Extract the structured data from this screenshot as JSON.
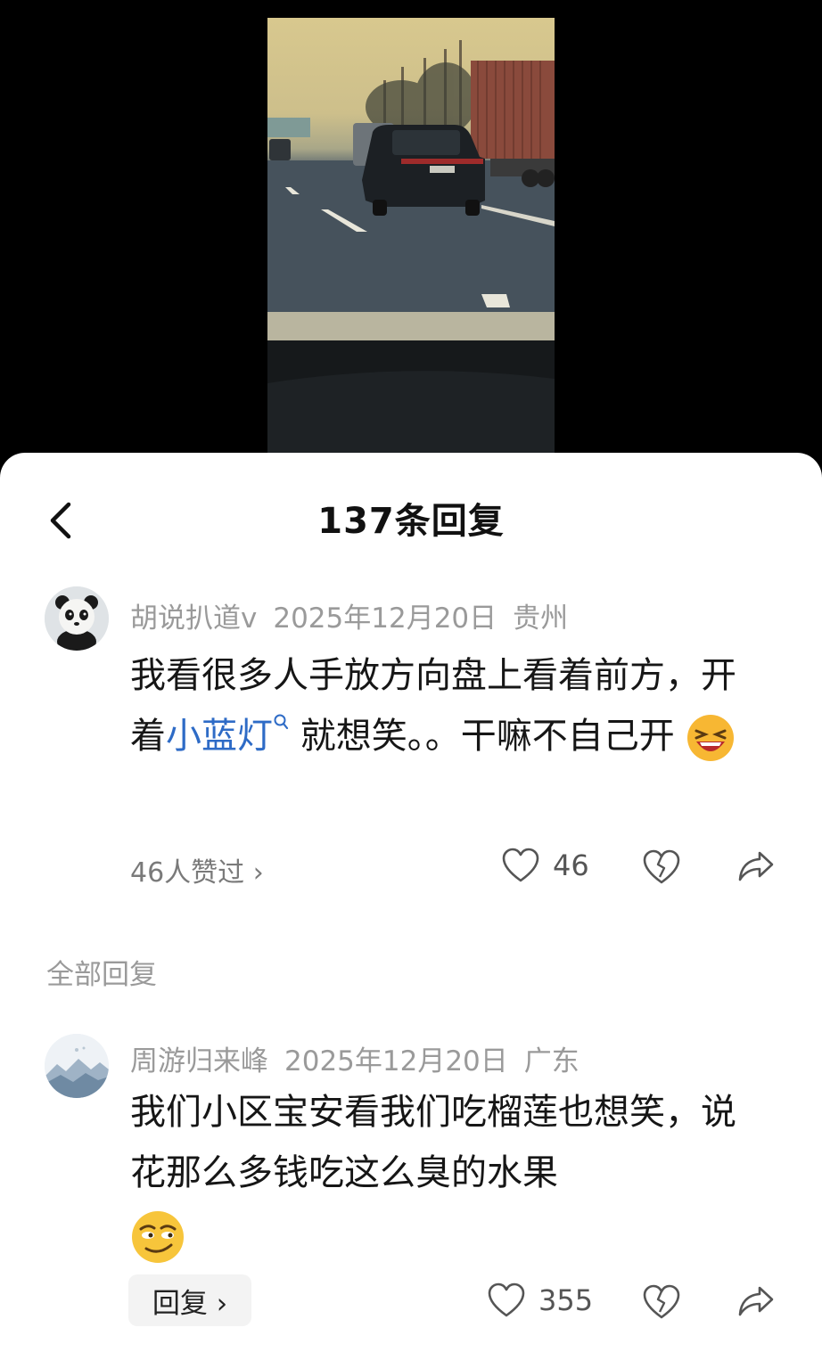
{
  "header": {
    "title": "137条回复"
  },
  "main_comment": {
    "username": "胡说扒道v",
    "date": "2025年12月20日",
    "location": "贵州",
    "text_part1": "我看很多人手放方向盘上看着前方，开着",
    "link_text": "小蓝灯",
    "text_part2": " 就想笑。。干嘛不自己开",
    "emoji": "laughing-emoji",
    "likes_summary": "46人赞过 ›",
    "like_count": "46"
  },
  "section_label": "全部回复",
  "reply": {
    "username": "周游归来峰",
    "date": "2025年12月20日",
    "location": "广东",
    "text": "我们小区宝安看我们吃榴莲也想笑，说花那么多钱吃这么臭的水果",
    "emoji": "smirk-emoji",
    "reply_label": "回复 ›",
    "like_count": "355"
  },
  "colors": {
    "link": "#2e6bc6",
    "meta": "#9a9a9a",
    "text": "#161616"
  }
}
